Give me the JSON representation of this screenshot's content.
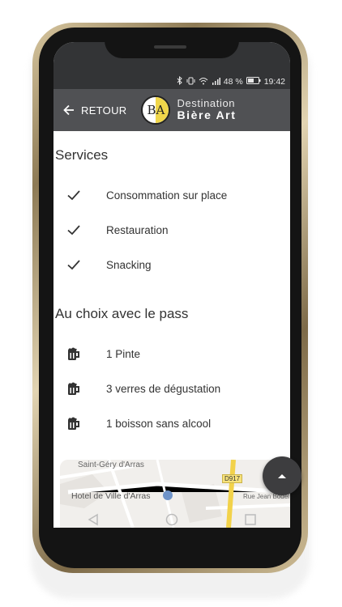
{
  "status_bar": {
    "battery_percent": "48 %",
    "time": "19:42"
  },
  "app_bar": {
    "back_label": "RETOUR",
    "logo_letters": "BA",
    "brand_line1": "Destination",
    "brand_line2": "Bière Art"
  },
  "services": {
    "title": "Services",
    "items": [
      {
        "label": "Consommation sur place",
        "icon": "check-icon"
      },
      {
        "label": "Restauration",
        "icon": "check-icon"
      },
      {
        "label": "Snacking",
        "icon": "check-icon"
      }
    ]
  },
  "pass": {
    "title": "Au choix avec le pass",
    "items": [
      {
        "label": "1 Pinte",
        "icon": "beer-mug-icon"
      },
      {
        "label": "3 verres de dégustation",
        "icon": "beer-mug-icon"
      },
      {
        "label": "1 boisson sans alcool",
        "icon": "beer-mug-icon"
      }
    ]
  },
  "map": {
    "labels": {
      "place1": "Saint-Géry d'Arras",
      "place2": "Hotel de Ville d'Arras",
      "road_badge": "D917",
      "street": "Rue Jean Bodel"
    }
  },
  "fab": {
    "icon": "chevron-up-icon"
  },
  "nav": {
    "icons": [
      "back-triangle-icon",
      "home-circle-icon",
      "recents-square-icon"
    ]
  },
  "colors": {
    "status_bar": "#333436",
    "app_bar": "#505154",
    "logo_accent": "#f0d64a",
    "road_yellow": "#f2d24a"
  }
}
